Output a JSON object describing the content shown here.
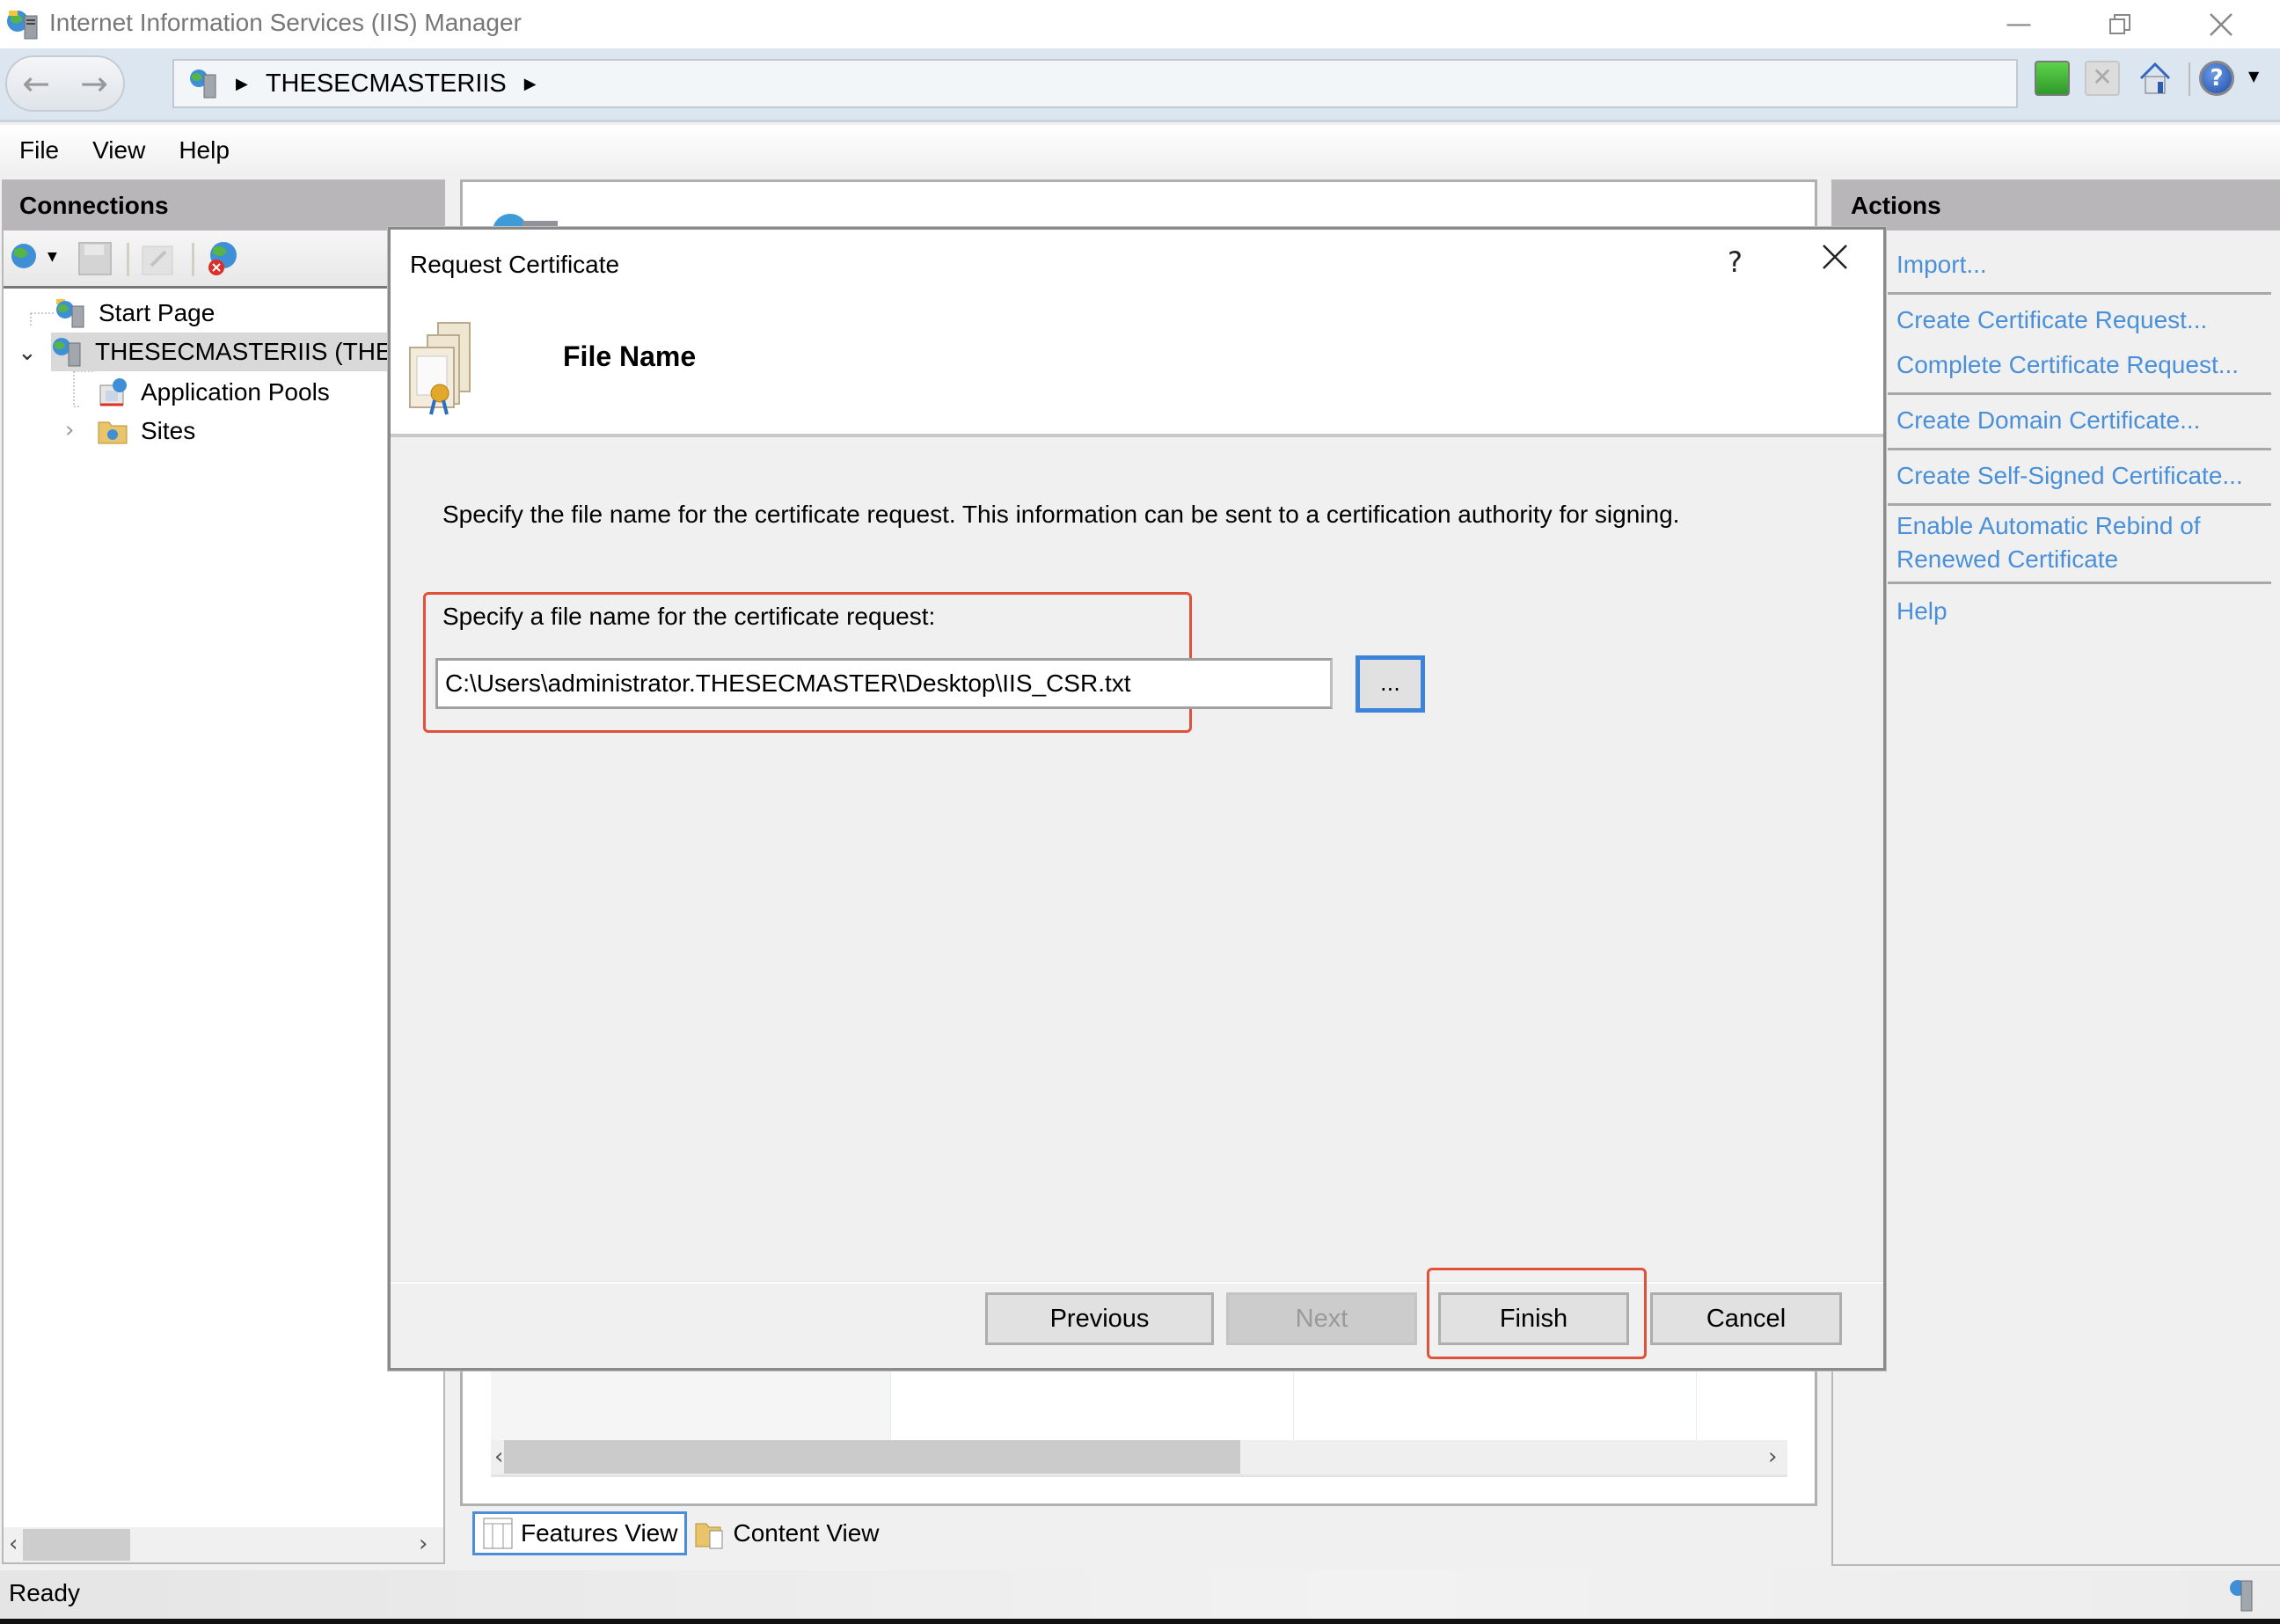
{
  "window": {
    "title": "Internet Information Services (IIS) Manager",
    "minimize_icon": "minimize-icon",
    "restore_icon": "restore-icon",
    "close_icon": "close-icon"
  },
  "address_bar": {
    "breadcrumb": [
      "THESECMASTERIIS"
    ],
    "toolbar_icons": [
      "refresh-icon",
      "stop-icon",
      "home-icon",
      "help-icon"
    ]
  },
  "menu": {
    "items": [
      "File",
      "View",
      "Help"
    ]
  },
  "connections": {
    "title": "Connections",
    "toolbar_icons": [
      "connect-icon",
      "save-icon",
      "up-icon",
      "disconnect-icon"
    ],
    "tree": [
      {
        "label": "Start Page",
        "icon": "start-page-icon",
        "level": 0
      },
      {
        "label": "THESECMASTERIIS (THESECMASTER\\administrator)",
        "visible_label": "THESECMASTERIIS (THES",
        "icon": "server-icon",
        "level": 0,
        "expanded": true,
        "selected": true
      },
      {
        "label": "Application Pools",
        "icon": "app-pools-icon",
        "level": 1
      },
      {
        "label": "Sites",
        "icon": "sites-folder-icon",
        "level": 1,
        "expanded": false
      }
    ]
  },
  "middle": {
    "view_tabs": [
      {
        "label": "Features View",
        "active": true
      },
      {
        "label": "Content View",
        "active": false
      }
    ]
  },
  "actions": {
    "title": "Actions",
    "items": [
      "Import...",
      "Create Certificate Request...",
      "Complete Certificate Request...",
      "Create Domain Certificate...",
      "Create Self-Signed Certificate...",
      "Enable Automatic Rebind of Renewed Certificate",
      "Help"
    ],
    "rebind_line1": "Enable Automatic Rebind of",
    "rebind_line2": "Renewed Certificate"
  },
  "status": {
    "text": "Ready"
  },
  "dialog": {
    "title": "Request Certificate",
    "help_label": "?",
    "close_label": "✕",
    "heading": "File Name",
    "description": "Specify the file name for the certificate request. This information can be sent to a certification authority for signing.",
    "field_label": "Specify a file name for the certificate request:",
    "file_path": "C:\\Users\\administrator.THESECMASTER\\Desktop\\IIS_CSR.txt",
    "browse_label": "...",
    "buttons": {
      "previous": "Previous",
      "next": "Next",
      "finish": "Finish",
      "cancel": "Cancel"
    },
    "next_enabled": false,
    "highlight_color": "#e0533a"
  },
  "colors": {
    "link": "#4a90d9",
    "focus_border": "#3c84d9",
    "panel_header": "#b8b6b9"
  }
}
